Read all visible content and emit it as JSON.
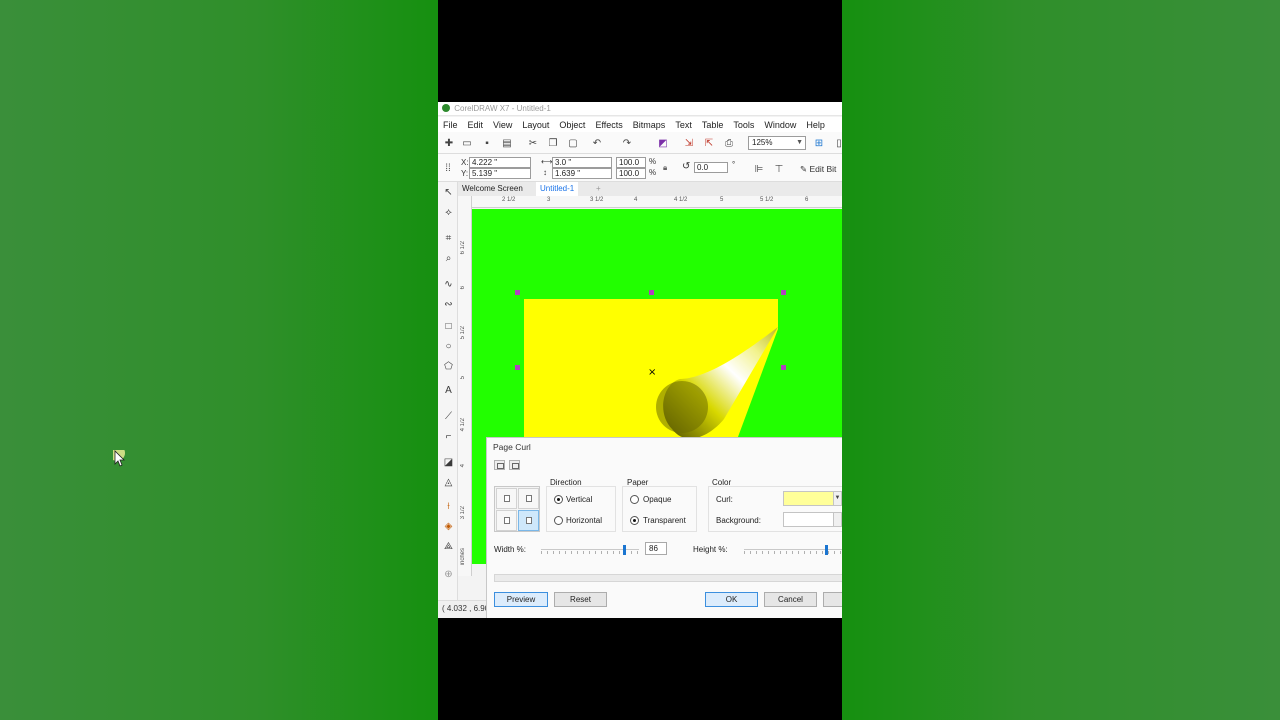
{
  "window": {
    "title": "CorelDRAW X7 - Untitled-1"
  },
  "menu": [
    "File",
    "Edit",
    "View",
    "Layout",
    "Object",
    "Effects",
    "Bitmaps",
    "Text",
    "Table",
    "Tools",
    "Window",
    "Help"
  ],
  "toolbar": {
    "zoom": "125%"
  },
  "property_bar": {
    "x_label": "X:",
    "x_value": "4.222 \"",
    "y_label": "Y:",
    "y_value": "5.139 \"",
    "width_value": "3.0 \"",
    "height_value": "1.639 \"",
    "scale_w": "100.0",
    "scale_h": "100.0",
    "pct": "%",
    "rotation": "0.0",
    "degree": "°",
    "edit_bitmap": "Edit Bit"
  },
  "tabs": [
    "Welcome Screen",
    "Untitled-1"
  ],
  "ruler": {
    "top": [
      "2 1/2",
      "3",
      "3 1/2",
      "4",
      "4 1/2",
      "5",
      "5 1/2",
      "6"
    ],
    "left": [
      "6 1/2",
      "6",
      "5 1/2",
      "5",
      "4 1/2",
      "4",
      "3 1/2"
    ],
    "unit": "inches"
  },
  "colors": {
    "canvas": "#22ff00",
    "page": "#ffff00",
    "curl": "#ffff99",
    "accent": "#1b75d0",
    "handle": "#b040c0"
  },
  "status": {
    "coords": "( 4.032 , 6.90"
  },
  "dialog": {
    "title": "Page Curl",
    "direction": {
      "label": "Direction",
      "vertical": "Vertical",
      "horizontal": "Horizontal",
      "selected": "Vertical"
    },
    "paper": {
      "label": "Paper",
      "opaque": "Opaque",
      "transparent": "Transparent",
      "selected": "Transparent"
    },
    "color": {
      "label": "Color",
      "curl_label": "Curl:",
      "background_label": "Background:"
    },
    "width_label": "Width %:",
    "width_value": "86",
    "height_label": "Height %:",
    "buttons": {
      "preview": "Preview",
      "reset": "Reset",
      "ok": "OK",
      "cancel": "Cancel"
    }
  }
}
